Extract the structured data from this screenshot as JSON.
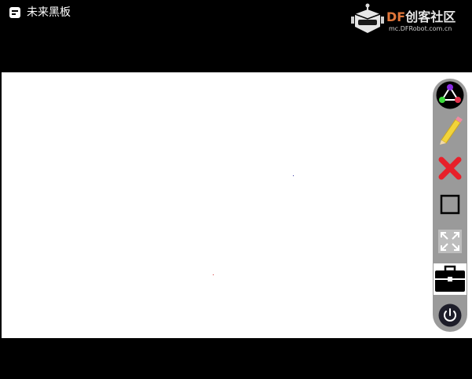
{
  "window": {
    "title": "未来黑板"
  },
  "watermark": {
    "brand_prefix": "DF",
    "brand_rest": "创客社区",
    "url": "mc.DFRobot.com.cn"
  },
  "colors": {
    "titlebar_bg": "#000000",
    "canvas_bg": "#ffffff",
    "toolbar_bg": "#9a9a9a",
    "brand_orange": "#e0763a",
    "eraser_red": "#e8202a",
    "pencil_yellow": "#f2d43a"
  },
  "toolbar": {
    "tools": [
      {
        "name": "color-picker",
        "icon": "color-triangle-icon"
      },
      {
        "name": "pencil",
        "icon": "pencil-icon"
      },
      {
        "name": "clear",
        "icon": "red-x-icon"
      },
      {
        "name": "shape",
        "icon": "square-icon"
      },
      {
        "name": "fullscreen",
        "icon": "expand-arrows-icon"
      },
      {
        "name": "toolbox",
        "icon": "toolbox-icon"
      },
      {
        "name": "power",
        "icon": "power-icon"
      }
    ]
  }
}
